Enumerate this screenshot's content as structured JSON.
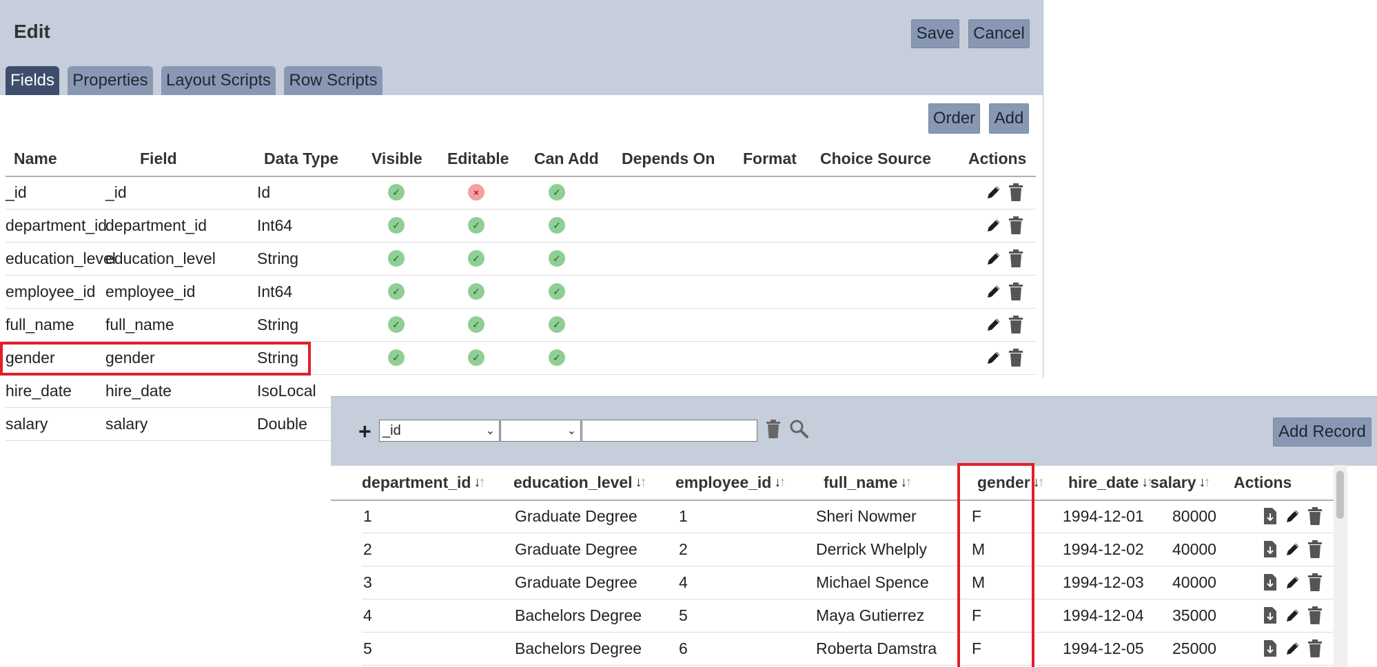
{
  "editor": {
    "title": "Edit",
    "save_label": "Save",
    "cancel_label": "Cancel",
    "tabs": [
      {
        "label": "Fields",
        "active": true
      },
      {
        "label": "Properties",
        "active": false
      },
      {
        "label": "Layout Scripts",
        "active": false
      },
      {
        "label": "Row Scripts",
        "active": false
      }
    ],
    "order_label": "Order",
    "add_label": "Add",
    "columns": [
      "Name",
      "Field",
      "Data Type",
      "Visible",
      "Editable",
      "Can Add",
      "Depends On",
      "Format",
      "Choice Source",
      "Actions"
    ],
    "rows": [
      {
        "name": "_id",
        "field": "_id",
        "type": "Id",
        "visible": true,
        "editable": false,
        "can_add": true
      },
      {
        "name": "department_id",
        "field": "department_id",
        "type": "Int64",
        "visible": true,
        "editable": true,
        "can_add": true
      },
      {
        "name": "education_level",
        "field": "education_level",
        "type": "String",
        "visible": true,
        "editable": true,
        "can_add": true
      },
      {
        "name": "employee_id",
        "field": "employee_id",
        "type": "Int64",
        "visible": true,
        "editable": true,
        "can_add": true
      },
      {
        "name": "full_name",
        "field": "full_name",
        "type": "String",
        "visible": true,
        "editable": true,
        "can_add": true
      },
      {
        "name": "gender",
        "field": "gender",
        "type": "String",
        "visible": true,
        "editable": true,
        "can_add": true
      },
      {
        "name": "hire_date",
        "field": "hire_date",
        "type": "IsoLocal",
        "visible": null,
        "editable": null,
        "can_add": null
      },
      {
        "name": "salary",
        "field": "salary",
        "type": "Double",
        "visible": null,
        "editable": null,
        "can_add": null
      }
    ],
    "icons": {
      "ok": "✓",
      "no": "×",
      "edit": "pencil-icon",
      "delete": "trash-icon"
    }
  },
  "records": {
    "add_icon": "+",
    "filter_field_value": "_id",
    "filter_operator_value": "",
    "add_record_label": "Add Record",
    "columns": [
      "department_id",
      "education_level",
      "employee_id",
      "full_name",
      "gender",
      "hire_date",
      "salary",
      "Actions"
    ],
    "rows": [
      {
        "department_id": "1",
        "education_level": "Graduate Degree",
        "employee_id": "1",
        "full_name": "Sheri Nowmer",
        "gender": "F",
        "hire_date": "1994-12-01",
        "salary": "80000"
      },
      {
        "department_id": "2",
        "education_level": "Graduate Degree",
        "employee_id": "2",
        "full_name": "Derrick Whelply",
        "gender": "M",
        "hire_date": "1994-12-02",
        "salary": "40000"
      },
      {
        "department_id": "3",
        "education_level": "Graduate Degree",
        "employee_id": "4",
        "full_name": "Michael Spence",
        "gender": "M",
        "hire_date": "1994-12-03",
        "salary": "40000"
      },
      {
        "department_id": "4",
        "education_level": "Bachelors Degree",
        "employee_id": "5",
        "full_name": "Maya Gutierrez",
        "gender": "F",
        "hire_date": "1994-12-04",
        "salary": "35000"
      },
      {
        "department_id": "5",
        "education_level": "Bachelors Degree",
        "employee_id": "6",
        "full_name": "Roberta Damstra",
        "gender": "F",
        "hire_date": "1994-12-05",
        "salary": "25000"
      }
    ]
  },
  "colors": {
    "header_bg": "#c5ceda",
    "button_bg": "#8898b3",
    "tab_active": "#3d4d6b",
    "highlight": "#e0202b",
    "ok": "#8fcf95",
    "no": "#f59ea3"
  }
}
